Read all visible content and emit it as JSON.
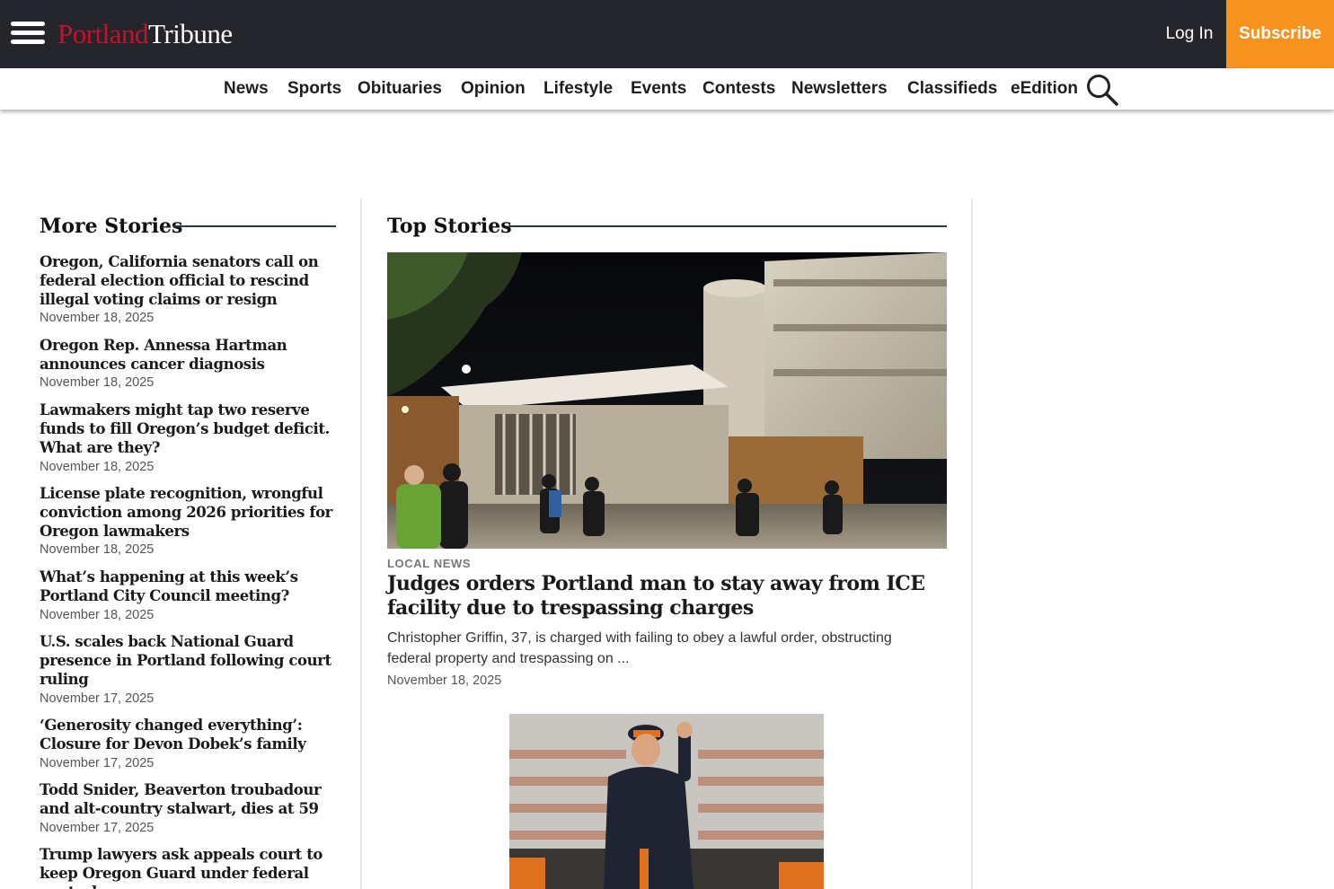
{
  "header": {
    "logo_part1": "Portland",
    "logo_part2": "Tribune",
    "login_label": "Log In",
    "subscribe_label": "Subscribe"
  },
  "nav": {
    "items": [
      "News",
      "Sports",
      "Obituaries",
      "Opinion",
      "Lifestyle",
      "Events",
      "Contests",
      "Newsletters",
      "Classifieds",
      "eEdition"
    ]
  },
  "more_stories": {
    "heading": "More Stories",
    "items": [
      {
        "title": "Oregon, California senators call on federal election official to rescind illegal voting claims or resign",
        "date": "November 18, 2025"
      },
      {
        "title": "Oregon Rep. Annessa Hartman announces cancer diagnosis",
        "date": "November 18, 2025"
      },
      {
        "title": "Lawmakers might tap two reserve funds to fill Oregon’s budget deficit. What are they?",
        "date": "November 18, 2025"
      },
      {
        "title": "License plate recognition, wrongful conviction among 2026 priorities for Oregon lawmakers",
        "date": "November 18, 2025"
      },
      {
        "title": "What’s happening at this week’s Portland City Council meeting?",
        "date": "November 18, 2025"
      },
      {
        "title": "U.S. scales back National Guard presence in Portland following court ruling",
        "date": "November 17, 2025"
      },
      {
        "title": "‘Generosity changed everything’: Closure for Devon Dobek’s family",
        "date": "November 17, 2025"
      },
      {
        "title": "Todd Snider, Beaverton troubadour and alt-country stalwart, dies at 59",
        "date": "November 17, 2025"
      },
      {
        "title": "Trump lawyers ask appeals court to keep Oregon Guard under federal control",
        "date": ""
      }
    ]
  },
  "top_stories": {
    "heading": "Top Stories",
    "lead": {
      "kicker": "LOCAL NEWS",
      "headline": "Judges orders Portland man to stay away from ICE facility due to trespassing charges",
      "summary": "Christopher Griffin, 37, is charged with failing to obey a lawful order, obstructing federal property and trespassing on ...",
      "date": "November 18, 2025"
    }
  },
  "colors": {
    "topbar": "#24262b",
    "brand_red": "#c8102e",
    "subscribe": "#f5931e",
    "rule": "#1c3b55"
  }
}
